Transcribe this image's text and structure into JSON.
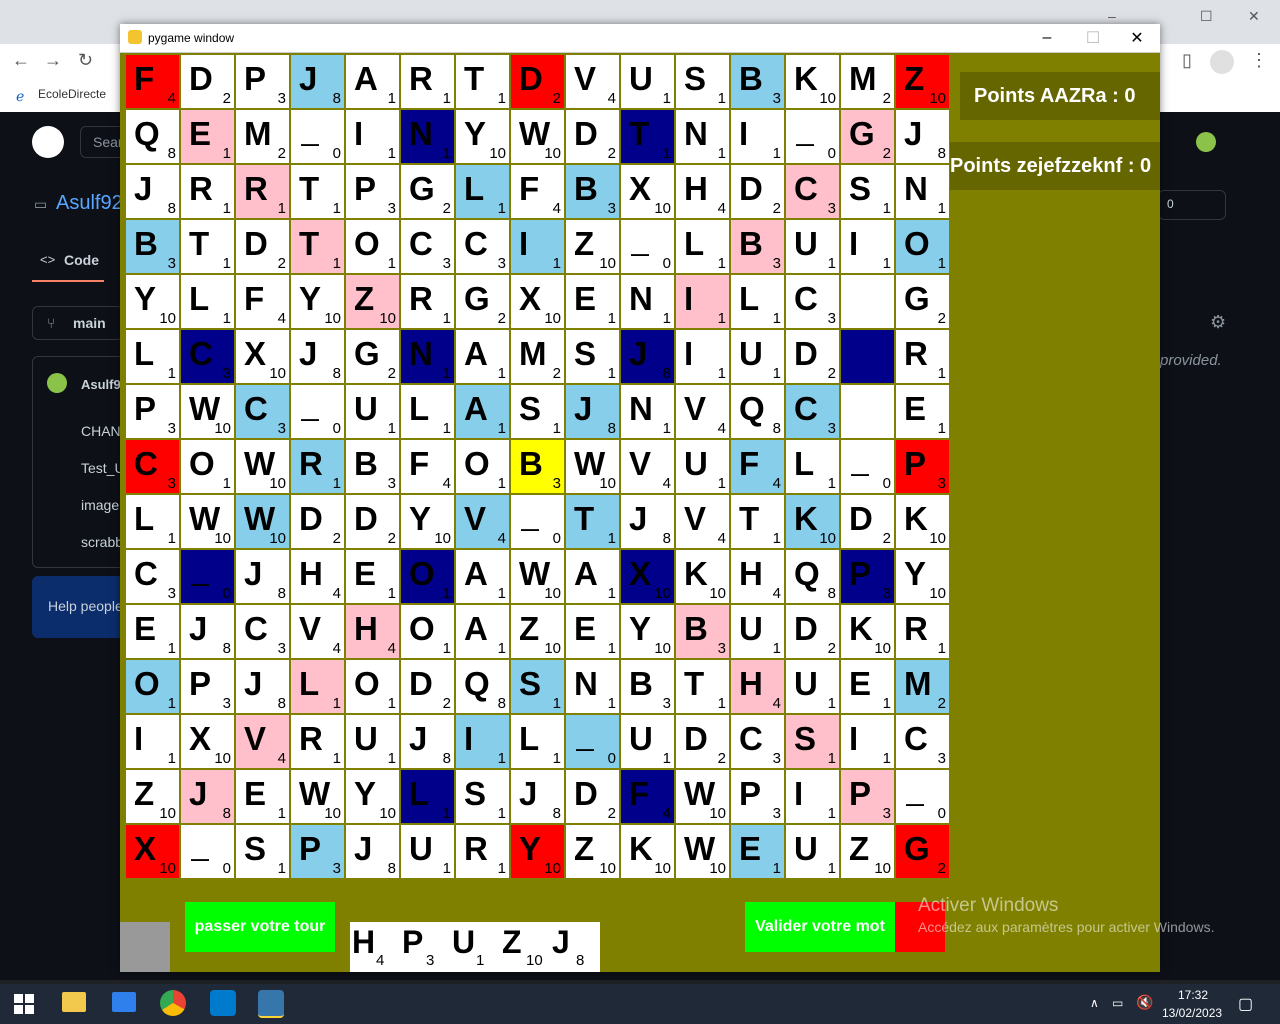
{
  "browser": {
    "bookmark": "EcoleDirecte",
    "window_controls": [
      "–",
      "☐",
      "✕"
    ]
  },
  "github": {
    "repo_name": "Asulf92",
    "code_tab": "Code",
    "branch": "main",
    "user": "Asulf9",
    "files": [
      "CHAN",
      "Test_U",
      "image",
      "scrabb"
    ],
    "help_text": "Help people",
    "provided_text": "provided.",
    "counter": "0",
    "search_placeholder": "Sear"
  },
  "pygame": {
    "title": "pygame window",
    "score_player1": "Points AAZRa : 0",
    "score_player2": "Points zejefzzeknf : 0",
    "pass_button": "passer votre tour",
    "validate_button": "Valider votre mot",
    "rack": [
      {
        "letter": "H",
        "points": "4"
      },
      {
        "letter": "P",
        "points": "3"
      },
      {
        "letter": "U",
        "points": "1"
      },
      {
        "letter": "Z",
        "points": "10"
      },
      {
        "letter": "J",
        "points": "8"
      }
    ],
    "board": [
      [
        "F4r",
        "D2w",
        "P3w",
        "J8b",
        "A1w",
        "R1w",
        "T1w",
        "D2r",
        "V4w",
        "U1w",
        "S1w",
        "B3b",
        "K10w",
        "M2w",
        "Z10r"
      ],
      [
        "Q8w",
        "E1p",
        "M2w",
        "_0w",
        "I1w",
        "N1n",
        "Y10w",
        "W10w",
        "D2w",
        "T1n",
        "N1w",
        "I1w",
        "_0w",
        "G2p",
        "J8w"
      ],
      [
        "J8w",
        "R1w",
        "R1p",
        "T1w",
        "P3w",
        "G2w",
        "L1b",
        "F4w",
        "B3b",
        "X10w",
        "H4w",
        "D2w",
        "C3p",
        "S1w",
        "N1w"
      ],
      [
        "B3b",
        "T1w",
        "D2w",
        "T1p",
        "O1w",
        "C3w",
        "C3w",
        "I1b",
        "Z10w",
        "_0w",
        "L1w",
        "B3p",
        "U1w",
        "I1w",
        "O1b"
      ],
      [
        "Y10w",
        "L1w",
        "F4w",
        "Y10w",
        "Z10p",
        "R1w",
        "G2w",
        "X10w",
        "E1w",
        "N1w",
        "I1p",
        "L1w",
        "C3w",
        "  w",
        "G2w"
      ],
      [
        "L1w",
        "C3n",
        "X10w",
        "J8w",
        "G2w",
        "N1n",
        "A1w",
        "M2w",
        "S1w",
        "J8n",
        "I1w",
        "U1w",
        "D2w",
        "  n",
        "R1w"
      ],
      [
        "P3w",
        "W10w",
        "C3b",
        "_0w",
        "U1w",
        "L1w",
        "A1b",
        "S1w",
        "J8b",
        "N1w",
        "V4w",
        "Q8w",
        "C3b",
        "  w",
        "E1w"
      ],
      [
        "C3r",
        "O1w",
        "W10w",
        "R1b",
        "B3w",
        "F4w",
        "O1w",
        "B3y",
        "W10w",
        "V4w",
        "U1w",
        "F4b",
        "L1w",
        "_0w",
        "P3r"
      ],
      [
        "L1w",
        "W10w",
        "W10b",
        "D2w",
        "D2w",
        "Y10w",
        "V4b",
        "_0w",
        "T1b",
        "J8w",
        "V4w",
        "T1w",
        "K10b",
        "D2w",
        "K10w"
      ],
      [
        "C3w",
        "_0n",
        "J8w",
        "H4w",
        "E1w",
        "O1n",
        "A1w",
        "W10w",
        "A1w",
        "X10n",
        "K10w",
        "H4w",
        "Q8w",
        "P3n",
        "Y10w"
      ],
      [
        "E1w",
        "J8w",
        "C3w",
        "V4w",
        "H4p",
        "O1w",
        "A1w",
        "Z10w",
        "E1w",
        "Y10w",
        "B3p",
        "U1w",
        "D2w",
        "K10w",
        "R1w"
      ],
      [
        "O1b",
        "P3w",
        "J8w",
        "L1p",
        "O1w",
        "D2w",
        "Q8w",
        "S1b",
        "N1w",
        "B3w",
        "T1w",
        "H4p",
        "U1w",
        "E1w",
        "M2b"
      ],
      [
        "I1w",
        "X10w",
        "V4p",
        "R1w",
        "U1w",
        "J8w",
        "I1b",
        "L1w",
        "_0b",
        "U1w",
        "D2w",
        "C3w",
        "S1p",
        "I1w",
        "C3w"
      ],
      [
        "Z10w",
        "J8p",
        "E1w",
        "W10w",
        "Y10w",
        "L1n",
        "S1w",
        "J8w",
        "D2w",
        "F4n",
        "W10w",
        "P3w",
        "I1w",
        "P3p",
        "_0w"
      ],
      [
        "X10r",
        "_0w",
        "S1w",
        "P3b",
        "J8w",
        "U1w",
        "R1w",
        "Y10r",
        "Z10w",
        "K10w",
        "W10w",
        "E1b",
        "U1w",
        "Z10w",
        "G2r"
      ]
    ],
    "tile_colors": {
      "w": "#ffffff",
      "r": "#ff0000",
      "b": "#87ceeb",
      "p": "#ffc0cb",
      "n": "#00008b",
      "y": "#ffff00"
    }
  },
  "windows": {
    "activate_title": "Activer Windows",
    "activate_sub": "Accédez aux paramètres pour activer Windows.",
    "time": "17:32",
    "date": "13/02/2023"
  }
}
